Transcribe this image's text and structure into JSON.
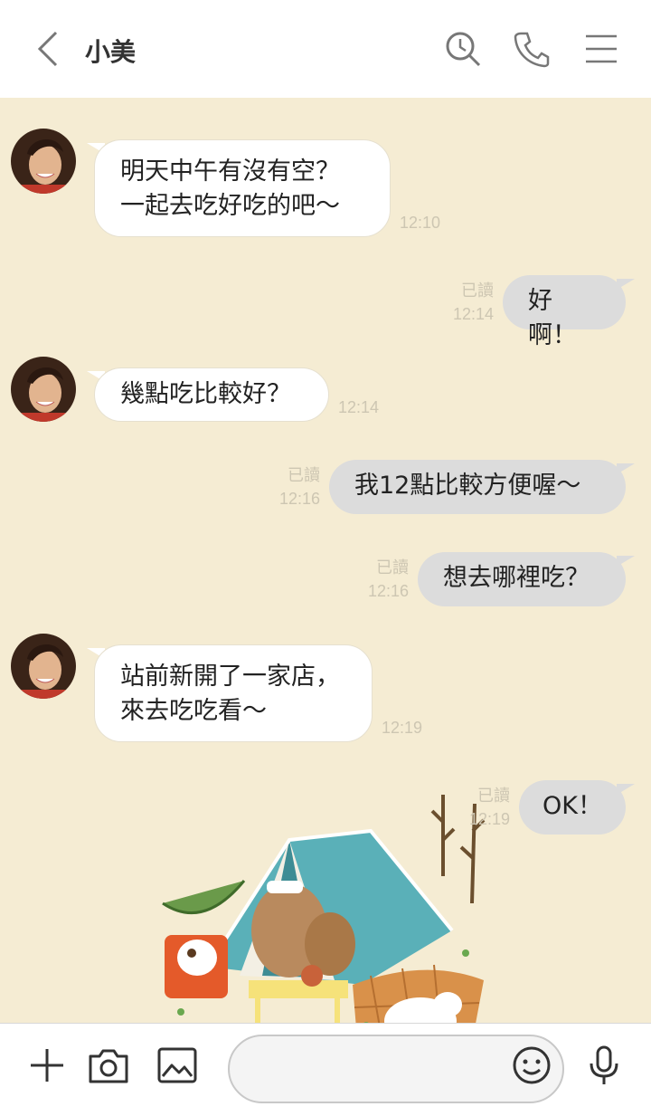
{
  "header": {
    "contact_name": "小美"
  },
  "messages": [
    {
      "from": "them",
      "lines": [
        "明天中午有沒有空？",
        "一起去吃好吃的吧～"
      ],
      "time": "12:10"
    },
    {
      "from": "me",
      "text": "好啊！",
      "read": "已讀",
      "time": "12:14"
    },
    {
      "from": "them",
      "lines": [
        "幾點吃比較好？"
      ],
      "time": "12:14"
    },
    {
      "from": "me",
      "text": "我12點比較方便喔～",
      "read": "已讀",
      "time": "12:16"
    },
    {
      "from": "me",
      "text": "想去哪裡吃？",
      "read": "已讀",
      "time": "12:16"
    },
    {
      "from": "them",
      "lines": [
        "站前新開了一家店，",
        "來去吃吃看～"
      ],
      "time": "12:19"
    },
    {
      "from": "me",
      "text": "OK！",
      "read": "已讀",
      "time": "12:19"
    }
  ],
  "icons": {
    "back": "chevron-left-icon",
    "search": "search-clock-icon",
    "call": "phone-icon",
    "menu": "hamburger-menu-icon",
    "add": "plus-icon",
    "camera": "camera-icon",
    "image": "image-icon",
    "emoji": "smiley-icon",
    "voice": "microphone-icon"
  },
  "colors": {
    "chat_background": "#f5ecd3",
    "incoming_bubble": "#ffffff",
    "outgoing_bubble": "#dcdcdc",
    "meta_text": "#cdc6b2"
  }
}
